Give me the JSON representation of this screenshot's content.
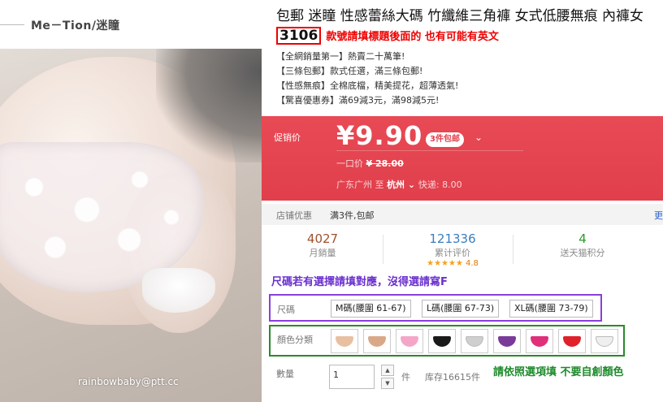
{
  "photo": {
    "brand": "Me－Tion/迷瞳",
    "watermark": "rainbowbaby@ptt.cc"
  },
  "title": {
    "text": "包郵 迷瞳 性感蕾絲大碼 竹纖維三角褲 女式低腰無痕 內褲女",
    "code": "3106",
    "note": "款號請填標題後面的 也有可能有英文"
  },
  "promos": [
    "【全網銷量第一】熱賣二十萬筆!",
    "【三條包郵】款式任選，滿三條包郵!",
    "【性感無痕】全棉底檔，精美提花，超薄透氣!",
    "【驚喜優惠券】滿69減3元，滿98減5元!"
  ],
  "price": {
    "label": "促销价",
    "value": "¥9.90",
    "badge": "3件包邮",
    "orig_label": "一口价",
    "orig_value": "¥ 28.00",
    "origin": "广东广州",
    "to": "至",
    "dest": "杭州",
    "express": "快递: 8.00"
  },
  "shop": {
    "label": "店铺优惠",
    "value": "满3件,包邮",
    "more": "更"
  },
  "stats": [
    {
      "num": "4027",
      "label": "月銷量",
      "color": "#a0522d"
    },
    {
      "num": "121336",
      "label": "累计评价",
      "color": "#3a7dbf"
    },
    {
      "num": "4",
      "label": "送天猫积分",
      "color": "#2a9a2a"
    }
  ],
  "rating": {
    "stars": "★★★★★",
    "score": "4.8"
  },
  "size_hint": "尺碼若有選擇請填對應，沒得選請寫F",
  "sizes": {
    "label": "尺碼",
    "options": [
      "M碼(腰圍 61-67)",
      "L碼(腰圍 67-73)",
      "XL碼(腰圍 73-79)"
    ]
  },
  "colors": {
    "label": "顏色分類",
    "swatches": [
      "#e8c0a0",
      "#d9a987",
      "#f4a6c8",
      "#1a1a1a",
      "#cfcfcf",
      "#7a3a9a",
      "#e0307a",
      "#e0202a",
      "#efefef"
    ]
  },
  "qty": {
    "label": "數量",
    "value": "1",
    "unit": "件",
    "stock": "库存16615件",
    "hint": "請依照選項填 不要自創顏色"
  }
}
